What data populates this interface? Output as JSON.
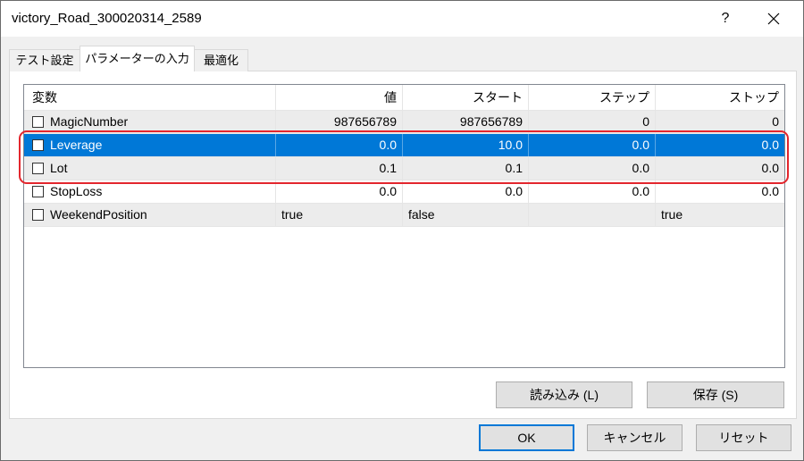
{
  "window": {
    "title": "victory_Road_300020314_2589",
    "help_label": "?",
    "close_icon": "close-icon"
  },
  "tabs": [
    {
      "label": "テスト設定",
      "active": false
    },
    {
      "label": "パラメーターの入力",
      "active": true
    },
    {
      "label": "最適化",
      "active": false
    }
  ],
  "table": {
    "columns": [
      "変数",
      "値",
      "スタート",
      "ステップ",
      "ストップ"
    ],
    "rows": [
      {
        "name": "MagicNumber",
        "checked": false,
        "selected": false,
        "value": "987656789",
        "start": "987656789",
        "step": "0",
        "stop": "0"
      },
      {
        "name": "Leverage",
        "checked": false,
        "selected": true,
        "value": "0.0",
        "start": "10.0",
        "step": "0.0",
        "stop": "0.0"
      },
      {
        "name": "Lot",
        "checked": false,
        "selected": false,
        "value": "0.1",
        "start": "0.1",
        "step": "0.0",
        "stop": "0.0"
      },
      {
        "name": "StopLoss",
        "checked": false,
        "selected": false,
        "value": "0.0",
        "start": "0.0",
        "step": "0.0",
        "stop": "0.0"
      },
      {
        "name": "WeekendPosition",
        "checked": false,
        "selected": false,
        "value": "true",
        "start": "false",
        "step": "",
        "stop": "true"
      }
    ]
  },
  "highlight": {
    "first_row": 1,
    "last_row": 2,
    "color": "#e3262d"
  },
  "panel_buttons": {
    "load_label": "読み込み (L)",
    "save_label": "保存 (S)"
  },
  "dialog_buttons": {
    "ok_label": "OK",
    "cancel_label": "キャンセル",
    "reset_label": "リセット"
  },
  "colors": {
    "selection": "#0078d7",
    "default_button_border": "#0078d7"
  }
}
